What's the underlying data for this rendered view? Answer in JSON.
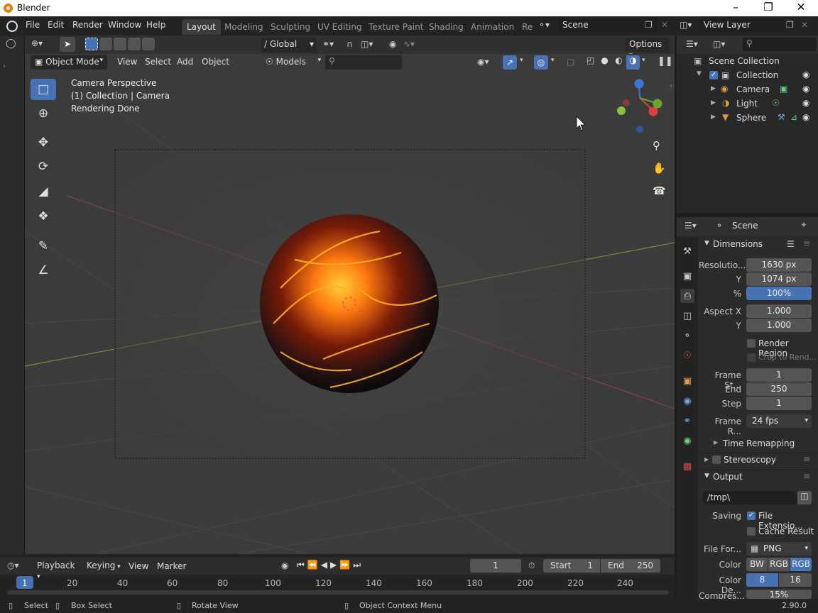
{
  "window": {
    "title": "Blender"
  },
  "menu": [
    "File",
    "Edit",
    "Render",
    "Window",
    "Help"
  ],
  "workspaces": [
    {
      "label": "Layout",
      "active": true
    },
    {
      "label": "Modeling"
    },
    {
      "label": "Sculpting"
    },
    {
      "label": "UV Editing"
    },
    {
      "label": "Texture Paint"
    },
    {
      "label": "Shading"
    },
    {
      "label": "Animation"
    },
    {
      "label": "Re"
    }
  ],
  "scene_field": "Scene",
  "view_layer_field": "View Layer",
  "viewport": {
    "transform_orientation": "Global",
    "options_label": "Options",
    "mode": "Object Mode",
    "menus": [
      "View",
      "Select",
      "Add",
      "Object"
    ],
    "collection_filter": "Models",
    "overlay_lines": [
      "Camera Perspective",
      "(1) Collection | Camera",
      "Rendering Done"
    ]
  },
  "outliner": {
    "root": "Scene Collection",
    "collection": "Collection",
    "objects": [
      "Camera",
      "Light",
      "Sphere"
    ]
  },
  "properties": {
    "header": "Scene",
    "dimensions": {
      "title": "Dimensions",
      "resolution_label": "Resolutio...",
      "resolution_x": "1630 px",
      "y_label": "Y",
      "resolution_y": "1074 px",
      "percent_label": "%",
      "percent": "100%",
      "aspect_x_label": "Aspect X",
      "aspect_x": "1.000",
      "aspect_y_label": "Y",
      "aspect_y": "1.000",
      "render_region": "Render Region",
      "crop": "Crop to Rend...",
      "frame_start_label": "Frame St...",
      "frame_start": "1",
      "end_label": "End",
      "frame_end": "250",
      "step_label": "Step",
      "step": "1",
      "frame_rate_label": "Frame R...",
      "frame_rate": "24 fps",
      "time_remapping": "Time Remapping"
    },
    "stereoscopy": "Stereoscopy",
    "output": {
      "title": "Output",
      "path": "/tmp\\",
      "saving_label": "Saving",
      "file_extension": "File Extensio...",
      "cache_result": "Cache Result",
      "file_format_label": "File For...",
      "file_format": "PNG",
      "color_label": "Color",
      "color_options": [
        "BW",
        "RGB",
        "RGB"
      ],
      "color_depth_label": "Color De...",
      "color_depth_options": [
        "8",
        "16"
      ],
      "compression_label": "Compres...",
      "compression": "15%"
    }
  },
  "timeline": {
    "menus": [
      "Playback",
      "Keying",
      "View",
      "Marker"
    ],
    "current_frame": "1",
    "start_label": "Start",
    "start": "1",
    "end_label": "End",
    "end": "250",
    "ruler": [
      "1",
      "20",
      "40",
      "60",
      "80",
      "100",
      "120",
      "140",
      "160",
      "180",
      "200",
      "220",
      "240"
    ]
  },
  "status": {
    "select": "Select",
    "box_select": "Box Select",
    "rotate_view": "Rotate View",
    "context_menu": "Object Context Menu",
    "version": "2.90.0"
  },
  "colors": {
    "accent": "#4772b3",
    "axis_x": "#e0413d",
    "axis_y": "#6aa533",
    "axis_z": "#3b7ad6"
  }
}
